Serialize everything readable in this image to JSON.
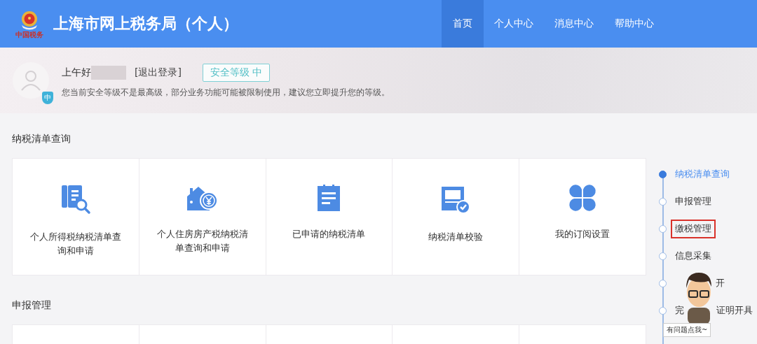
{
  "header": {
    "logo_caption": "中国税务",
    "title": "上海市网上税务局（个人）",
    "tabs": [
      {
        "label": "首页",
        "selected": true
      },
      {
        "label": "个人中心",
        "selected": false
      },
      {
        "label": "消息中心",
        "selected": false
      },
      {
        "label": "帮助中心",
        "selected": false
      }
    ]
  },
  "user": {
    "greeting": "上午好",
    "logout": "[退出登录]",
    "security_badge": "安全等级 中",
    "shield_text": "中",
    "notice": "您当前安全等级不是最高级，部分业务功能可能被限制使用，建议您立即提升您的等级。"
  },
  "sections": [
    {
      "title": "纳税清单查询",
      "cards": [
        {
          "kind": "search-doc",
          "label": "个人所得税纳税清单查询和申请"
        },
        {
          "kind": "house",
          "label": "个人住房房产税纳税清单查询和申请"
        },
        {
          "kind": "notepad",
          "label": "已申请的纳税清单"
        },
        {
          "kind": "verify",
          "label": "纳税清单校验"
        },
        {
          "kind": "clover",
          "label": "我的订阅设置"
        }
      ]
    },
    {
      "title": "申报管理",
      "cards": [
        {
          "kind": "blank"
        },
        {
          "kind": "blank"
        },
        {
          "kind": "blank"
        },
        {
          "kind": "blank"
        },
        {
          "kind": "blank"
        }
      ]
    }
  ],
  "side_nav": [
    {
      "parts": [
        "纳税清单查询"
      ],
      "kind": "plain",
      "selected": true,
      "highlighted": false
    },
    {
      "parts": [
        "申报管理"
      ],
      "kind": "plain",
      "selected": false,
      "highlighted": false
    },
    {
      "parts": [
        "缴税管理"
      ],
      "kind": "plain",
      "selected": false,
      "highlighted": true
    },
    {
      "parts": [
        "信息采集"
      ],
      "kind": "plain",
      "selected": false,
      "highlighted": false
    },
    {
      "parts": [
        "开"
      ],
      "kind": "covered",
      "selected": false,
      "highlighted": false
    },
    {
      "parts": [
        "完",
        "证明开具"
      ],
      "kind": "plain",
      "selected": false,
      "highlighted": false
    }
  ],
  "assistant": {
    "tooltip": "有问题点我~"
  }
}
